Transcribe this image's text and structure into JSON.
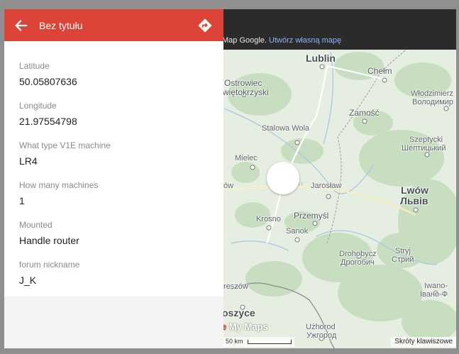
{
  "panel": {
    "title": "Bez tytułu",
    "fields": [
      {
        "label": "Latitude",
        "value": "50.05807636"
      },
      {
        "label": "Longitude",
        "value": "21.97554798"
      },
      {
        "label": "What type V1E machine",
        "value": "LR4"
      },
      {
        "label": "How many machines",
        "value": "1"
      },
      {
        "label": "Mounted",
        "value": "Handle router"
      },
      {
        "label": "forum nickname",
        "value": "J_K"
      }
    ]
  },
  "map": {
    "attribution_text": "Map Google.",
    "attribution_link": "Utwórz własną mapę",
    "logo_accent": "e",
    "logo_text": " My Maps",
    "scale": "50 km",
    "shortcuts": "Skróty klawiszowe",
    "cities": {
      "lublin": "Lublin",
      "chelm": "Chełm",
      "ostrowiec1": "Ostrowiec",
      "ostrowiec2": "więtokrzyski",
      "wlodzimierz1": "Włodzimierz",
      "wlodzimierz2": "Володимир",
      "zamosc": "Zamość",
      "stalowa": "Stalowa Wola",
      "szeptycki1": "Szeptycki",
      "szeptycki2": "Шептицький",
      "mielec": "Mielec",
      "tarnow": "ów",
      "rzeszow": "Rzeszów",
      "jaroslaw": "Jarosław",
      "lwow1": "Lwów",
      "lwow2": "Львів",
      "przemysl": "Przemyśl",
      "krosno": "Krosno",
      "sanok": "Sanok",
      "drohobycz1": "Drohobycz",
      "drohobycz2": "Дрогобич",
      "stryj1": "Stryj",
      "stryj2": "Стрий",
      "iwano1": "Iwano-",
      "iwano2": "Івано-Ф",
      "koszyce": "oszyce",
      "uzhorod1": "Użhorod",
      "uzhorod2": "Ужгород",
      "reszow": "reszów"
    }
  },
  "colors": {
    "header": "#db4437",
    "topbar": "#2b2b2b",
    "marker": "#9c27b0",
    "link": "#8ab4f8"
  }
}
